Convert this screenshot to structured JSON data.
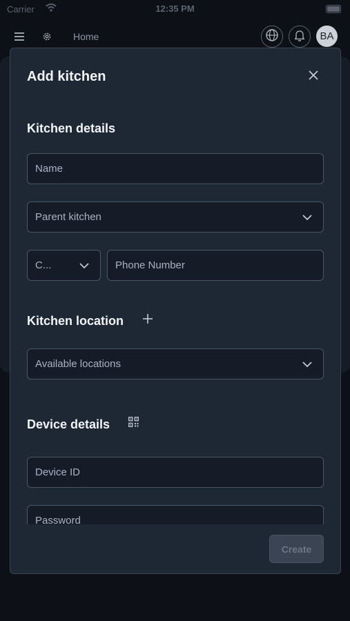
{
  "status_bar": {
    "carrier": "Carrier",
    "time": "12:35 PM"
  },
  "nav": {
    "menu_icon": "hamburger-icon",
    "settings_icon": "gear-icon",
    "home_label": "Home",
    "globe_icon": "globe-icon",
    "bell_icon": "bell-icon",
    "avatar_initials": "BA"
  },
  "modal": {
    "title": "Add kitchen",
    "close_icon": "close-icon",
    "kitchen_details": {
      "heading": "Kitchen details",
      "name_placeholder": "Name",
      "parent_kitchen_placeholder": "Parent kitchen",
      "country_code_value": "C...",
      "phone_placeholder": "Phone Number"
    },
    "kitchen_location": {
      "heading": "Kitchen location",
      "add_icon": "plus-icon",
      "locations_placeholder": "Available locations"
    },
    "device_details": {
      "heading": "Device details",
      "qr_icon": "qr-code-icon",
      "device_id_placeholder": "Device ID",
      "password_placeholder": "Password"
    },
    "create_label": "Create"
  },
  "colors": {
    "background": "#0d1117",
    "modal_bg": "#1e2835",
    "field_bg": "#151c28",
    "field_border": "#4a5566",
    "disabled_button": "#3a4453"
  }
}
